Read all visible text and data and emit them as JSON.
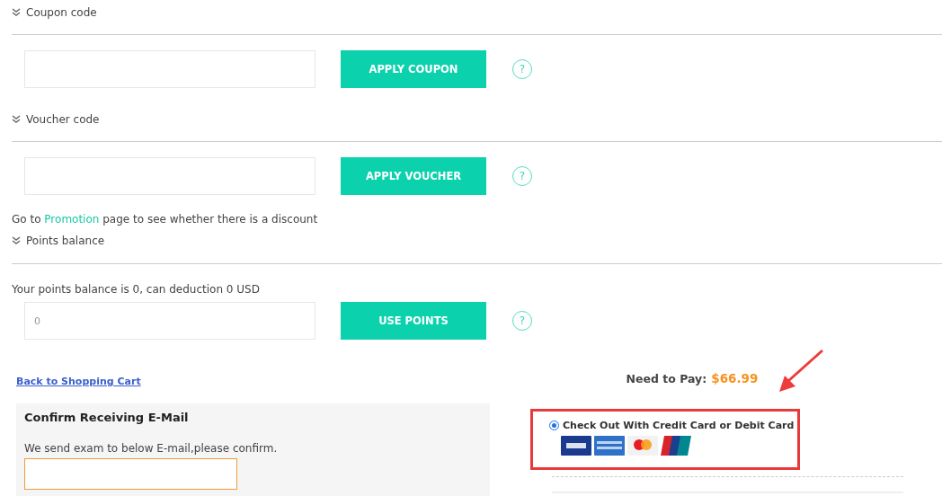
{
  "sections": [
    {
      "title": "Coupon code",
      "button": "APPLY COUPON"
    },
    {
      "title": "Voucher code",
      "button": "APPLY VOUCHER",
      "note": {
        "before": "Go to",
        "link": "Promotion",
        "after": "page to see whether there is a discount"
      }
    },
    {
      "title": "Points balance",
      "info": "Your points balance is 0, can deduction 0 USD",
      "field": {
        "value": "0"
      },
      "button": "USE POINTS"
    }
  ],
  "help_mark": "?",
  "back_link": "Back to Shopping Cart",
  "email_card": {
    "title": "Confirm Receiving E-Mail",
    "text": "We send exam to below E-mail,please confirm."
  },
  "pay": {
    "label": "Need to Pay:",
    "amount": "$66.99"
  },
  "payment_option": {
    "label": "Check Out With Credit Card or Debit Card",
    "selected": true
  }
}
